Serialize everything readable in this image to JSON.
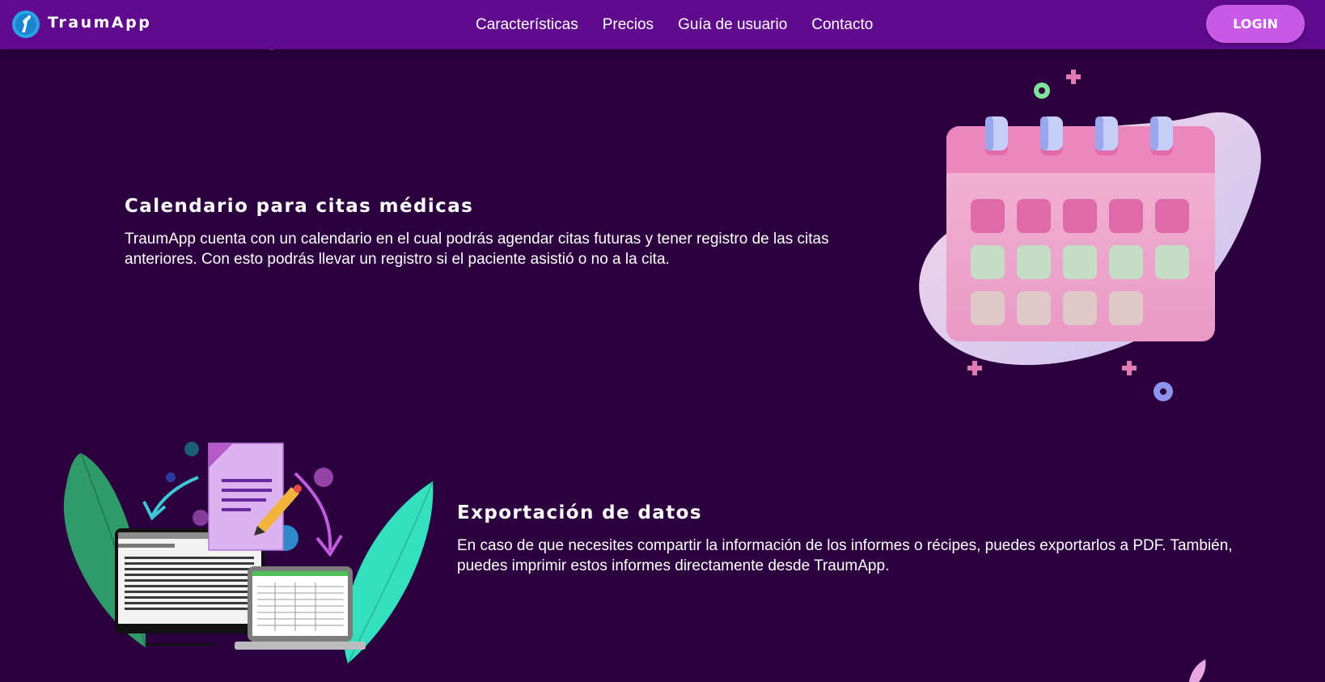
{
  "brand": {
    "name": "TraumApp"
  },
  "nav": {
    "links": [
      "Características",
      "Precios",
      "Guía de usuario",
      "Contacto"
    ],
    "login_label": "LOGIN"
  },
  "features": [
    {
      "title": "Calendario para citas médicas",
      "description": "TraumApp cuenta con un calendario en el cual podrás agendar citas futuras y tener registro de las citas anteriores. Con esto podrás llevar un registro si el paciente asistió o no a la cita.",
      "illustration": "calendar-illustration"
    },
    {
      "title": "Exportación de datos",
      "description": "En caso de que necesites compartir la información de los informes o récipes, puedes exportarlos a PDF. También, puedes imprimir estos informes directamente desde TraumApp.",
      "illustration": "export-data-illustration"
    }
  ],
  "colors": {
    "background": "#2c003f",
    "navbar": "#600b8e",
    "login_button": "#c859e6",
    "text": "#ffffff"
  }
}
